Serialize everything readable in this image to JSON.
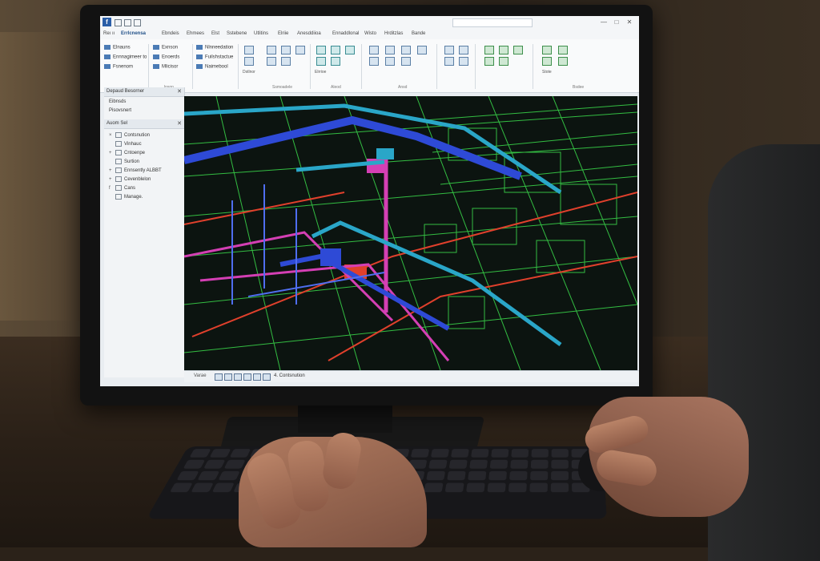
{
  "window": {
    "app_logo": "f",
    "search_placeholder": "",
    "controls": [
      "—",
      "□",
      "✕"
    ]
  },
  "ribbon": {
    "tabs": [
      "Reı ıı",
      "Errlcnensa",
      "Ebndeis",
      "Ehmees",
      "Elst",
      "Sstebene",
      "Utlitins",
      "Elriie",
      "Anesddiioa",
      "Ennaddlonal",
      "Wisto",
      "Hrditzlas",
      "Bande"
    ],
    "left_commands": [
      "Elnauns",
      "Ennnagimeer to",
      "Fsnenom"
    ],
    "second_commands": [
      "Exnson",
      "Enoerds",
      "Mlicisor"
    ],
    "third_commands": [
      "Nlnneedation",
      "Fuilshstactue",
      "Naimebool"
    ],
    "small_labels": [
      "Dstlnor",
      "Elrrioe",
      "Stote"
    ],
    "group_labels": [
      "lnson",
      "Ssmoadele",
      "Aleod",
      "Ansd",
      "Bsdee"
    ]
  },
  "left_panel": {
    "project_browser": {
      "title": "Depaud Besorner",
      "items": [
        "Eibnsds",
        "Pisovsnert"
      ]
    },
    "tree": {
      "title": "Auom Sel",
      "items": [
        {
          "marker": "×",
          "label": "Contsnution"
        },
        {
          "marker": "",
          "label": "Vinhauc"
        },
        {
          "marker": "+",
          "label": "Cntoenpe"
        },
        {
          "marker": "",
          "label": "Surtion"
        },
        {
          "marker": "+",
          "label": "Ennsently ALBBT"
        },
        {
          "marker": "+",
          "label": "Cevenblelon"
        },
        {
          "marker": "f",
          "label": "Cans"
        },
        {
          "marker": "",
          "label": "Manage."
        }
      ]
    }
  },
  "status_bar": {
    "scale": "Varae",
    "text": "4. Contsnution"
  },
  "colors": {
    "pipe_blue": "#2e4ad6",
    "pipe_cyan": "#2aa6c8",
    "pipe_magenta": "#d43fb4",
    "pipe_red": "#e0402c",
    "wire_green": "#38d048",
    "viewport_bg": "#0c1410"
  }
}
